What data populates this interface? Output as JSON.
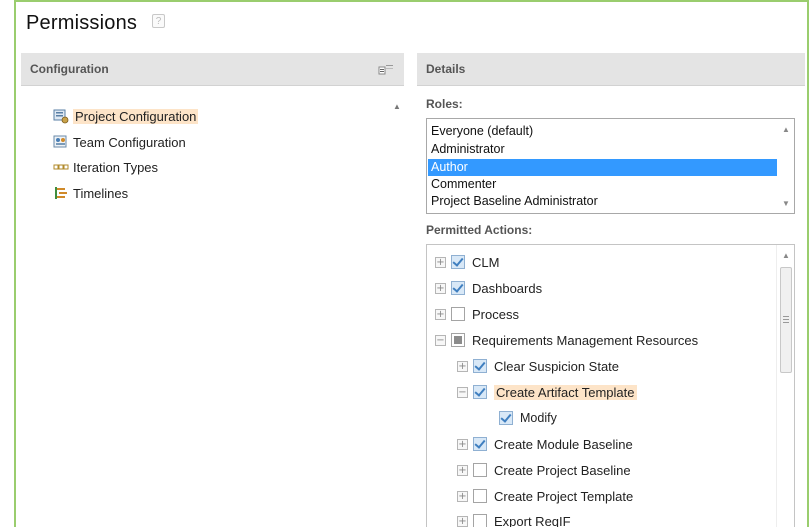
{
  "page": {
    "title": "Permissions",
    "help": "?"
  },
  "left_panel": {
    "header": "Configuration",
    "items": [
      {
        "label": "Project Configuration",
        "icon": "project-config-icon",
        "selected": true
      },
      {
        "label": "Team Configuration",
        "icon": "team-config-icon",
        "selected": false
      },
      {
        "label": "Iteration Types",
        "icon": "iteration-types-icon",
        "selected": false
      },
      {
        "label": "Timelines",
        "icon": "timelines-icon",
        "selected": false
      }
    ]
  },
  "right_panel": {
    "header": "Details",
    "roles_label": "Roles:",
    "roles": [
      "Everyone (default)",
      "Administrator",
      "Author",
      "Commenter",
      "Project Baseline Administrator"
    ],
    "selected_role": "Author",
    "actions_label": "Permitted Actions:",
    "actions": [
      {
        "label": "CLM",
        "state": "checked",
        "expander": "+",
        "level": 0
      },
      {
        "label": "Dashboards",
        "state": "checked",
        "expander": "+",
        "level": 0
      },
      {
        "label": "Process",
        "state": "unchecked",
        "expander": "+",
        "level": 0
      },
      {
        "label": "Requirements Management Resources",
        "state": "partial",
        "expander": "−",
        "level": 0
      },
      {
        "label": "Clear Suspicion State",
        "state": "checked",
        "expander": "+",
        "level": 1
      },
      {
        "label": "Create Artifact Template",
        "state": "checked",
        "expander": "−",
        "level": 1,
        "highlight": true
      },
      {
        "label": "Modify",
        "state": "checked",
        "expander": "",
        "level": 2
      },
      {
        "label": "Create Module Baseline",
        "state": "checked",
        "expander": "+",
        "level": 1
      },
      {
        "label": "Create Project Baseline",
        "state": "unchecked",
        "expander": "+",
        "level": 1
      },
      {
        "label": "Create Project Template",
        "state": "unchecked",
        "expander": "+",
        "level": 1
      },
      {
        "label": "Export ReqIF",
        "state": "unchecked",
        "expander": "+",
        "level": 1
      }
    ]
  },
  "colors": {
    "frame_border": "#9acd6e",
    "selection": "#3399ff",
    "highlight": "#fde4c8"
  }
}
